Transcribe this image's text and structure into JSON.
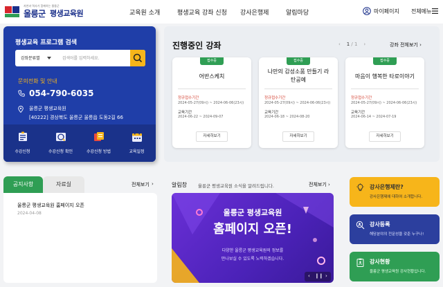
{
  "colors": {
    "brand_blue": "#1f3ea8",
    "accent_yellow": "#f7b51a",
    "accent_green": "#2f9e54",
    "banner_purple": "#5a28c8",
    "bank_navy": "#2c3f9e",
    "status_green": "#2f9e54"
  },
  "header": {
    "logo_sub": "자연과 역사가 함께하는 울릉군",
    "logo_name": "울릉군",
    "site_name": "평생교육원",
    "nav": [
      "교육원 소개",
      "평생교육 강좌 신청",
      "강사은행제",
      "알림마당"
    ],
    "mypage": "마이페이지",
    "allmenu": "전체메뉴"
  },
  "search_panel": {
    "title": "평생교육 프로그램 검색",
    "select_value": "강좌분류별",
    "input_placeholder": "검색어를 입력하세요.",
    "contact_label": "문의전화 및 안내",
    "phone": "054-790-6035",
    "address_name": "울릉군 평생교육원",
    "address": "[40222] 경상북도 울릉군 울릉읍 도동2길 66",
    "quick_links": [
      {
        "label": "수강신청",
        "icon": "register-icon"
      },
      {
        "label": "수강신청 확인",
        "icon": "check-icon"
      },
      {
        "label": "수강신청 방법",
        "icon": "guide-icon"
      },
      {
        "label": "교육일정",
        "icon": "calendar-icon"
      }
    ]
  },
  "progress": {
    "title": "진행중인 강좌",
    "page_current": "1",
    "page_sep": "/",
    "page_total": "1",
    "view_all": "강좌 전체보기",
    "courses": [
      {
        "status": "접수중",
        "name": "어반스케치",
        "apply_label": "정규접수기간",
        "apply_period": "2024-05-27(09시) ~ 2024-06-06(23시)",
        "edu_label": "교육기간",
        "edu_period": "2024-06-22 ~ 2024-09-07",
        "detail": "자세히보기"
      },
      {
        "status": "접수중",
        "name": "나만의 감성소품 만들기 라탄공예",
        "apply_label": "정규접수기간",
        "apply_period": "2024-05-27(09시) ~ 2024-06-06(23시)",
        "edu_label": "교육기간",
        "edu_period": "2024-06-18 ~ 2024-08-20",
        "detail": "자세히보기"
      },
      {
        "status": "접수중",
        "name": "마음이 행복한 타로이야기",
        "apply_label": "정규접수기간",
        "apply_period": "2024-05-27(09시) ~ 2024-06-06(23시)",
        "edu_label": "교육기간",
        "edu_period": "2024-06-14 ~ 2024-07-19",
        "detail": "자세히보기"
      }
    ]
  },
  "notice": {
    "tab_active": "공지사항",
    "tab_inactive": "자료실",
    "more": "전체보기",
    "items": [
      {
        "title": "울릉군 평생교육원 홈페이지 오픈",
        "date": "2024-04-08"
      }
    ]
  },
  "popup": {
    "label": "알림창",
    "desc": "울릉군 평생교육원 소식을 알려드립니다.",
    "more": "전체보기",
    "banner_small": "울릉군 평생교육원",
    "banner_big": "홈페이지 오픈!",
    "banner_desc1": "다양한 울릉군 평생교육원의 정보를",
    "banner_desc2": "만나보실 수 있도록 노력하겠습니다."
  },
  "right_panels": [
    {
      "title": "강사은행제란?",
      "desc": "강사은행제에 대하여 소개합니다.",
      "icon": "lightbulb-icon",
      "bg": "#f7b51a",
      "color": "#333"
    },
    {
      "title": "강사등록",
      "desc": "해당분야의 전문성을 갖춘 누구나!",
      "icon": "search-user-icon",
      "bg": "#2c3f9e",
      "color": "#fff"
    },
    {
      "title": "강사현황",
      "desc": "울릉군 평생교육원 강사현황입니다.",
      "icon": "clipboard-icon",
      "bg": "#2f9e54",
      "color": "#fff"
    }
  ]
}
